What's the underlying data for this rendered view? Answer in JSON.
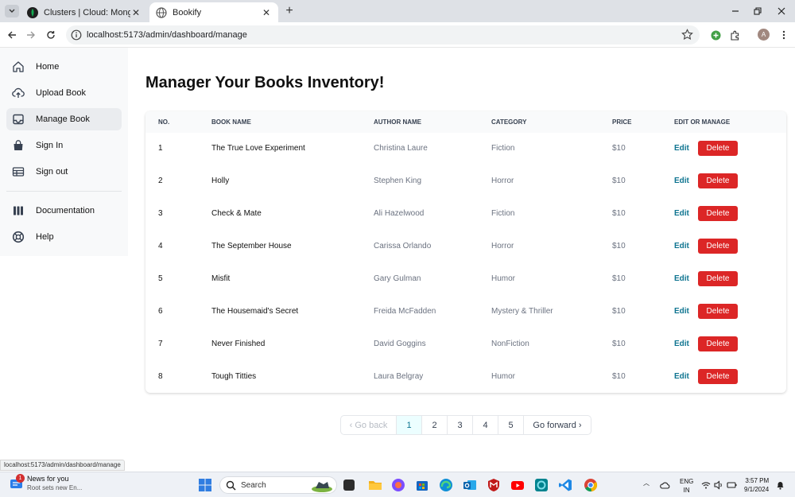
{
  "browser": {
    "tabs": [
      {
        "title": "Clusters | Cloud: MongoDB Clo",
        "icon": "mongodb-leaf-icon"
      },
      {
        "title": "Bookify",
        "icon": "globe-icon"
      }
    ],
    "url": "localhost:5173/admin/dashboard/manage",
    "status_url": "localhost:5173/admin/dashboard/manage",
    "profile_initial": "A"
  },
  "sidebar": {
    "items": [
      {
        "label": "Home",
        "icon": "home-icon"
      },
      {
        "label": "Upload Book",
        "icon": "cloud-upload-icon"
      },
      {
        "label": "Manage Book",
        "icon": "inbox-icon"
      },
      {
        "label": "Sign In",
        "icon": "shopping-bag-icon"
      },
      {
        "label": "Sign out",
        "icon": "table-icon"
      },
      {
        "label": "Documentation",
        "icon": "columns-icon"
      },
      {
        "label": "Help",
        "icon": "support-icon"
      }
    ]
  },
  "main": {
    "title": "Manager Your Books Inventory!"
  },
  "table": {
    "headers": [
      "NO.",
      "BOOK NAME",
      "AUTHOR NAME",
      "CATEGORY",
      "PRICE",
      "EDIT OR MANAGE"
    ],
    "edit_label": "Edit",
    "delete_label": "Delete",
    "rows": [
      {
        "no": "1",
        "book": "The True Love Experiment",
        "author": "Christina Laure",
        "category": "Fiction",
        "price": "$10"
      },
      {
        "no": "2",
        "book": "Holly",
        "author": "Stephen King",
        "category": "Horror",
        "price": "$10"
      },
      {
        "no": "3",
        "book": "Check & Mate",
        "author": "Ali Hazelwood",
        "category": "Fiction",
        "price": "$10"
      },
      {
        "no": "4",
        "book": "The September House",
        "author": "Carissa Orlando",
        "category": "Horror",
        "price": "$10"
      },
      {
        "no": "5",
        "book": "Misfit",
        "author": "Gary Gulman",
        "category": "Humor",
        "price": "$10"
      },
      {
        "no": "6",
        "book": "The Housemaid's Secret",
        "author": "Freida McFadden",
        "category": "Mystery & Thriller",
        "price": "$10"
      },
      {
        "no": "7",
        "book": "Never Finished",
        "author": "David Goggins",
        "category": "NonFiction",
        "price": "$10"
      },
      {
        "no": "8",
        "book": "Tough Titties",
        "author": "Laura Belgray",
        "category": "Humor",
        "price": "$10"
      }
    ]
  },
  "pagination": {
    "back_label": "Go back",
    "forward_label": "Go forward",
    "pages": [
      "1",
      "2",
      "3",
      "4",
      "5"
    ],
    "current": "1"
  },
  "taskbar": {
    "news_title": "News for you",
    "news_sub": "Root sets new En...",
    "news_badge": "1",
    "search_placeholder": "Search",
    "lang_1": "ENG",
    "lang_2": "IN",
    "time": "3:57 PM",
    "date": "9/1/2024"
  },
  "colors": {
    "accent": "#0e7490",
    "delete": "#dc2626",
    "sidebar_bg": "#f8f9fa"
  }
}
